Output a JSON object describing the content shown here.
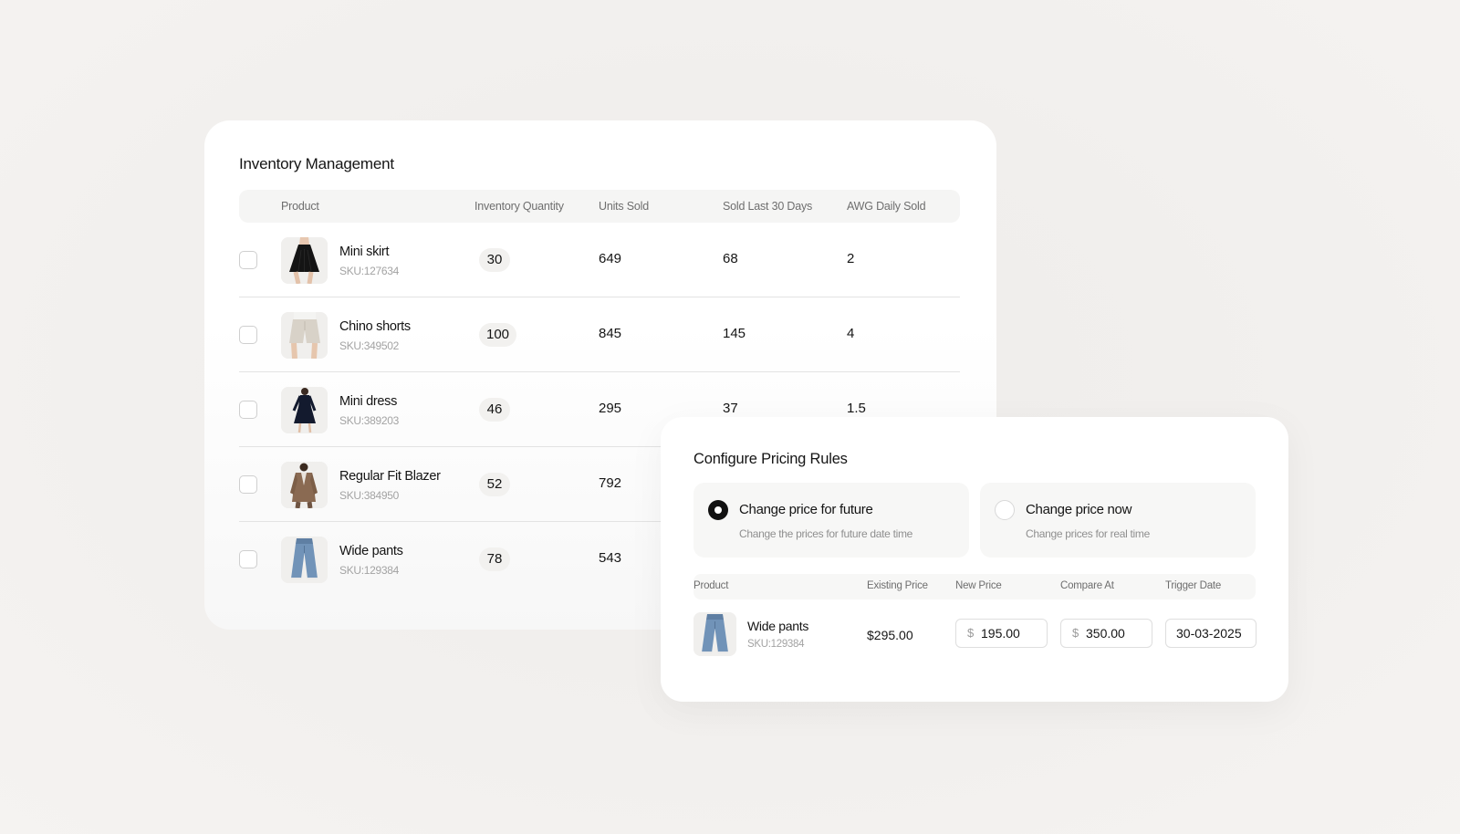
{
  "inventory": {
    "title": "Inventory Management",
    "columns": [
      "Product",
      "Inventory Quantity",
      "Units Sold",
      "Sold Last 30 Days",
      "AWG Daily Sold"
    ],
    "rows": [
      {
        "name": "Mini skirt",
        "sku": "SKU:127634",
        "quantity": "30",
        "units_sold": "649",
        "sold_30": "68",
        "avg_daily": "2",
        "image": "skirt-image"
      },
      {
        "name": "Chino shorts",
        "sku": "SKU:349502",
        "quantity": "100",
        "units_sold": "845",
        "sold_30": "145",
        "avg_daily": "4",
        "image": "shorts-image"
      },
      {
        "name": "Mini dress",
        "sku": "SKU:389203",
        "quantity": "46",
        "units_sold": "295",
        "sold_30": "37",
        "avg_daily": "1.5",
        "image": "dress-image"
      },
      {
        "name": "Regular Fit Blazer",
        "sku": "SKU:384950",
        "quantity": "52",
        "units_sold": "792",
        "sold_30": "",
        "avg_daily": "",
        "image": "blazer-image"
      },
      {
        "name": "Wide pants",
        "sku": "SKU:129384",
        "quantity": "78",
        "units_sold": "543",
        "sold_30": "",
        "avg_daily": "",
        "image": "pants-image"
      }
    ]
  },
  "pricing": {
    "title": "Configure Pricing Rules",
    "options": [
      {
        "label": "Change price for future",
        "description": "Change the prices for future date time",
        "selected": true
      },
      {
        "label": "Change price now",
        "description": "Change prices for real time",
        "selected": false
      }
    ],
    "columns": [
      "Product",
      "Existing Price",
      "New Price",
      "Compare At",
      "Trigger Date"
    ],
    "row": {
      "name": "Wide pants",
      "sku": "SKU:129384",
      "existing_price": "$295.00",
      "currency_symbol": "$",
      "new_price": "195.00",
      "compare_at": "350.00",
      "trigger_date": "30-03-2025",
      "image": "pants-image"
    }
  }
}
